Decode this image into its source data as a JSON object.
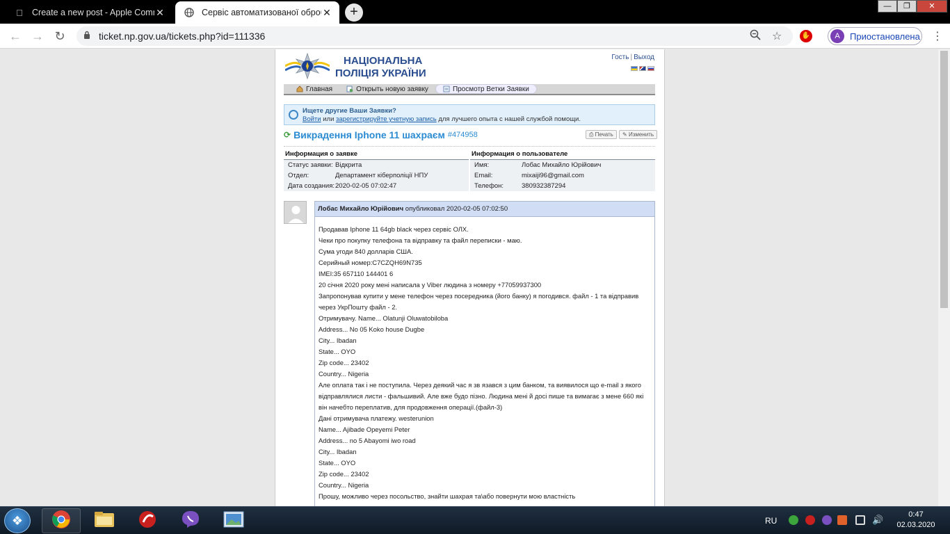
{
  "browser": {
    "tabs": [
      {
        "title": "Create a new post - Apple Comm",
        "active": false
      },
      {
        "title": "Сервіс автоматизованої оброб",
        "active": true
      }
    ],
    "url": "ticket.np.gov.ua/tickets.php?id=111336",
    "profile": {
      "initial": "A",
      "label": "Приостановлена"
    }
  },
  "site": {
    "brand_line1": "НАЦІОНАЛЬНА",
    "brand_line2": "ПОЛІЦІЯ УКРАЇНИ",
    "guest": "Гость",
    "logout": "Выход",
    "nav": [
      {
        "label": "Главная"
      },
      {
        "label": "Открыть новую заявку"
      },
      {
        "label": "Просмотр Ветки Заявки"
      }
    ],
    "notice": {
      "title": "Ищете другие Ваши Заявки?",
      "login": "Войти",
      "or": "или",
      "register": "зарегистрируйте учетную запись",
      "rest": "для лучшего опыта с нашей службой помощи."
    }
  },
  "ticket": {
    "title": "Викрадення Iphone 11 шахраєм",
    "number": "#474958",
    "print_label": "Печать",
    "edit_label": "Изменить",
    "info_header": "Информация о заявке",
    "user_header": "Информация о пользователе",
    "info": [
      {
        "k": "Статус заявки:",
        "v": "Відкрита"
      },
      {
        "k": "Отдел:",
        "v": "Департамент кіберполіції НПУ"
      },
      {
        "k": "Дата создания:",
        "v": "2020-02-05 07:02:47"
      }
    ],
    "user": [
      {
        "k": "Имя:",
        "v": "Лобас Михайло Юрійович"
      },
      {
        "k": "Email:",
        "v": "mixaiji96@gmail.com"
      },
      {
        "k": "Телефон:",
        "v": "380932387294"
      }
    ]
  },
  "post": {
    "author": "Лобас Михайло Юрійович",
    "meta": "опубликовал 2020-02-05 07:02:50",
    "lines": [
      "Продавав Iphone 11 64gb black через сервіс ОЛХ.",
      "Чеки про покупку телефона та відправку та файл переписки - маю.",
      "Сума угоди 840 долларів США.",
      "Серийный номер:C7CZQH69N735",
      "IMEI:35 657110 144401 6",
      "20 січня 2020 року мені написала у Viber людина з номеру +77059937300",
      "Запропонував купити у мене телефон через посередника (його банку) я погодився. файл - 1 та відправив",
      "через УкрПошту файл - 2.",
      "Отримувачу. Name... Olatunji Oluwatobiloba",
      "Address... No 05 Koko house Dugbe",
      "City... Ibadan",
      "State... OYO",
      "Zip code... 23402",
      "Country... Nigeria",
      "Але оплата так і не поступила. Через деякий час я зв язався з цим банком, та виявилося що e-mail з якого",
      "відправлялися листи - фальшивий. Але вже будо пізно. Людина мені й досі пише та вимагає з мене 660 які",
      "він начебто переплатив, для продовження операції.(файл-3)",
      "Дані отримувача платежу. westerunion",
      "Name... Ajibade Opeyemi Peter",
      "Address... no 5 Abayomi iwo road",
      "City... Ibadan",
      "State... OYO",
      "Zip code... 23402",
      "Country... Nigeria",
      "Прошу, можливо через посольство, знайти шахрая та\\або повернути мою властність"
    ]
  },
  "taskbar": {
    "lang": "RU",
    "time": "0:47",
    "date": "02.03.2020"
  }
}
